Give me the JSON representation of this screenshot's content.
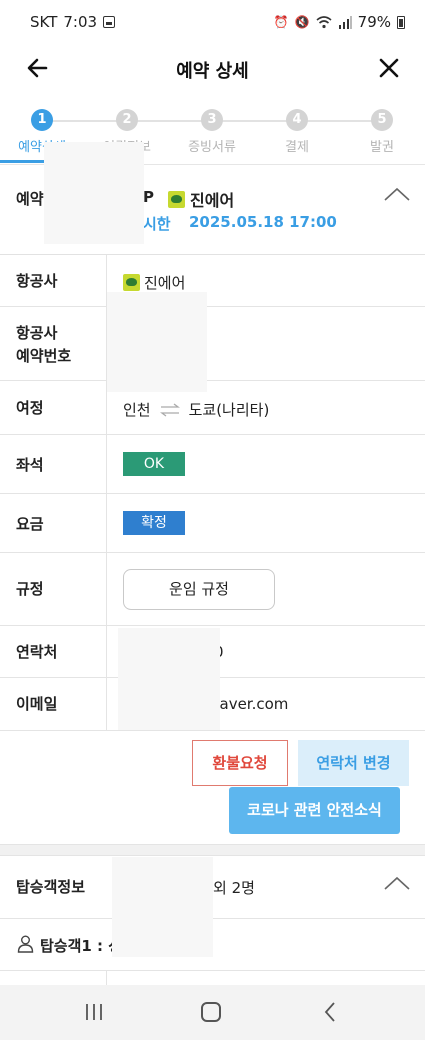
{
  "status_bar": {
    "carrier": "SKT",
    "time": "7:03",
    "battery": "79%"
  },
  "header": {
    "title": "예약 상세"
  },
  "steps": [
    {
      "num": "1",
      "label": "예약상세"
    },
    {
      "num": "2",
      "label": "여권정보"
    },
    {
      "num": "3",
      "label": "증빙서류"
    },
    {
      "num": "4",
      "label": "결제"
    },
    {
      "num": "5",
      "label": "발권"
    }
  ],
  "summary": {
    "label": "예약",
    "code": "P",
    "airline": "진에어",
    "time_prefix": "시한",
    "deadline": "2025.05.18 17:00"
  },
  "details": {
    "airline_label": "항공사",
    "airline_value": "진에어",
    "booking_label_line1": "항공사",
    "booking_label_line2": "예약번호",
    "route_label": "여정",
    "route_from": "인천",
    "route_to": "도쿄(나리타)",
    "seat_label": "좌석",
    "seat_status": "OK",
    "fare_label": "요금",
    "fare_status": "확정",
    "rule_label": "규정",
    "rule_button": "운임 규정",
    "contact_label": "연락처",
    "contact_value": "0",
    "email_label": "이메일",
    "email_value": "@naver.com"
  },
  "actions": {
    "refund": "환불요청",
    "change_contact": "연락처 변경",
    "corona_news": "코로나 관련 안전소식"
  },
  "passengers": {
    "title": "탑승객정보",
    "count_suffix": "외 2명",
    "first_label": "탑승객1 : 성"
  },
  "colors": {
    "accent": "#3a9ee4",
    "ok_badge": "#2b9a76",
    "confirm_badge": "#2f7fcf",
    "refund_text": "#e0483c"
  }
}
